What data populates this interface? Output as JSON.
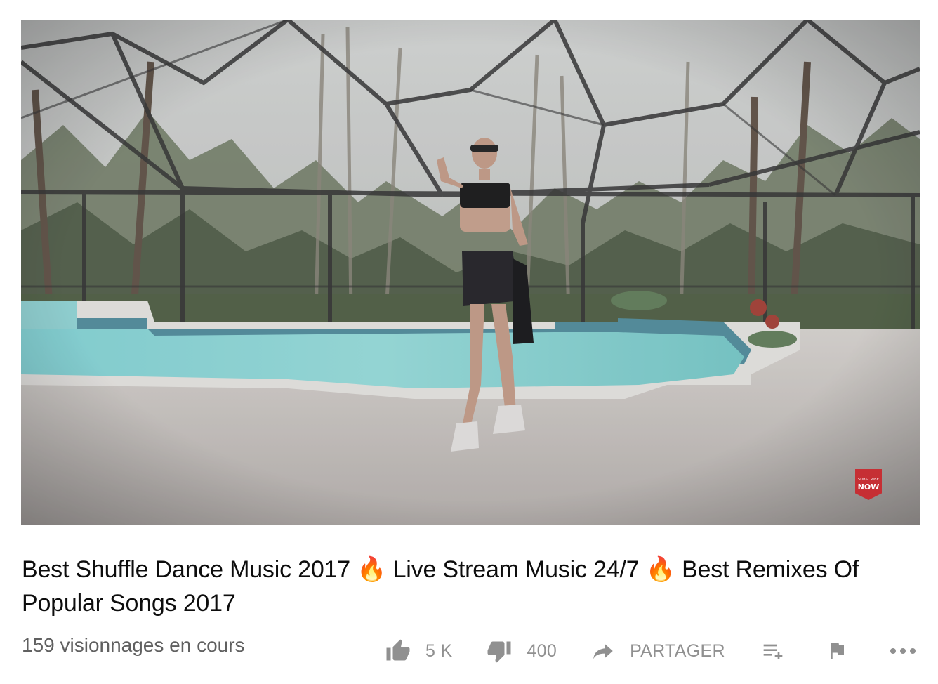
{
  "player": {
    "badge_small": "SUBSCRIBE",
    "badge_big": "NOW"
  },
  "video": {
    "title": "Best Shuffle Dance Music 2017 🔥 Live Stream Music 24/7 🔥 Best Remixes Of Popular Songs 2017",
    "views": "159 visionnages en cours"
  },
  "actions": {
    "like_count": "5 K",
    "dislike_count": "400",
    "share_label": "PARTAGER"
  },
  "icons": {
    "like": "thumbs-up-icon",
    "dislike": "thumbs-down-icon",
    "share": "share-arrow-icon",
    "add_to": "playlist-add-icon",
    "report": "flag-icon",
    "more": "more-horizontal-icon"
  },
  "colors": {
    "title": "#0d0d0d",
    "meta": "#606060",
    "action": "#909090",
    "badge": "#c62f34"
  }
}
